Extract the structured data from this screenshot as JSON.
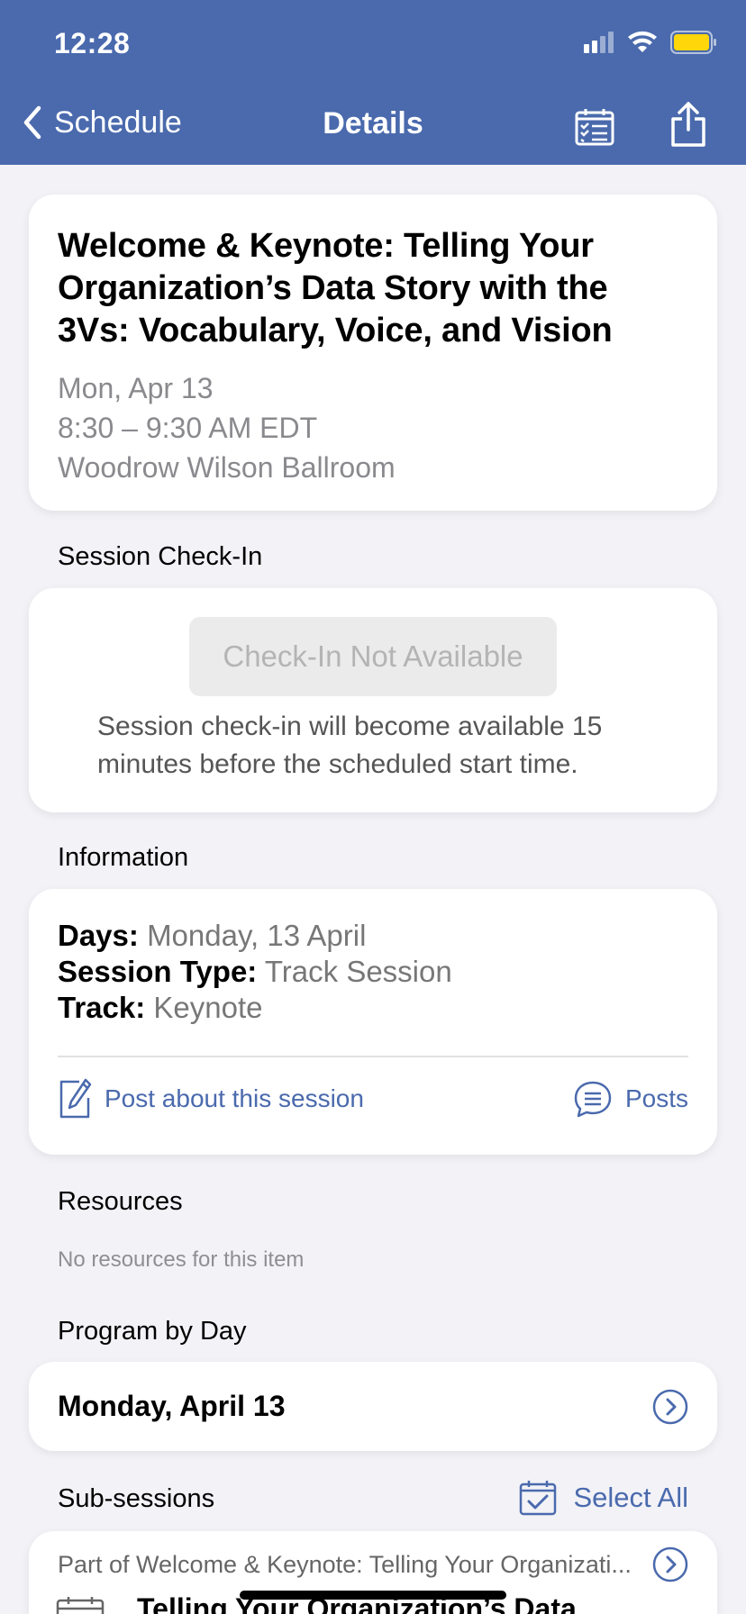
{
  "status_bar": {
    "time": "12:28"
  },
  "nav": {
    "back_label": "Schedule",
    "title": "Details"
  },
  "session": {
    "title": "Welcome & Keynote: Telling Your Organization’s Data Story with the 3Vs: Vocabulary, Voice, and Vision",
    "date": "Mon, Apr 13",
    "time": "8:30 – 9:30 AM EDT",
    "location": "Woodrow Wilson Ballroom"
  },
  "checkin": {
    "section_label": "Session Check-In",
    "button_label": "Check-In Not Available",
    "note": "Session check-in will become available 15 minutes before the scheduled start time."
  },
  "information": {
    "section_label": "Information",
    "rows": [
      {
        "key": "Days:",
        "value": "Monday, 13 April"
      },
      {
        "key": "Session Type:",
        "value": "Track Session"
      },
      {
        "key": "Track:",
        "value": "Keynote"
      }
    ],
    "post_label": "Post about this session",
    "posts_label": "Posts"
  },
  "resources": {
    "section_label": "Resources",
    "empty_text": "No resources for this item"
  },
  "program_by_day": {
    "section_label": "Program by Day",
    "day_label": "Monday, April 13"
  },
  "subsessions": {
    "section_label": "Sub-sessions",
    "select_all_label": "Select All",
    "parent_text": "Part of Welcome & Keynote: Telling Your Organizati...",
    "first_title": "Telling Your Organization’s Data"
  },
  "colors": {
    "accent": "#4a6aad",
    "battery": "#ffd60a",
    "background": "#f2f2f7"
  },
  "icons": {
    "back": "chevron-left-icon",
    "calendar_list": "calendar-list-icon",
    "share": "share-icon",
    "compose": "compose-icon",
    "posts": "chat-bubble-icon",
    "chevron_circle": "chevron-right-circle-icon",
    "calendar_check": "calendar-check-icon"
  }
}
